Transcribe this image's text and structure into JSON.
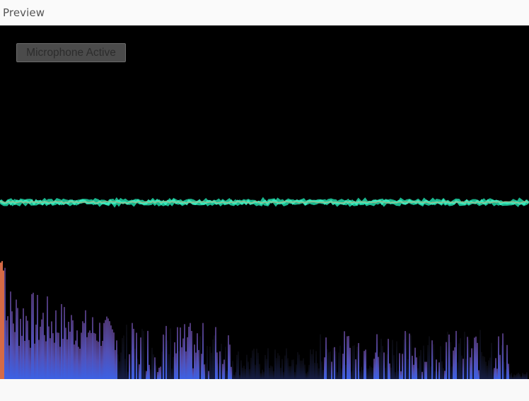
{
  "panel": {
    "title": "Preview"
  },
  "controls": {
    "mic_status_label": "Microphone Active"
  },
  "visualizer": {
    "waveform_colors": [
      "#1fd9a8",
      "#3ef0c2",
      "#9ab88a"
    ],
    "spectrum_colors": {
      "low": "#e0704a",
      "mid": "#8a5fa8",
      "high": "#3d5fe0"
    }
  }
}
